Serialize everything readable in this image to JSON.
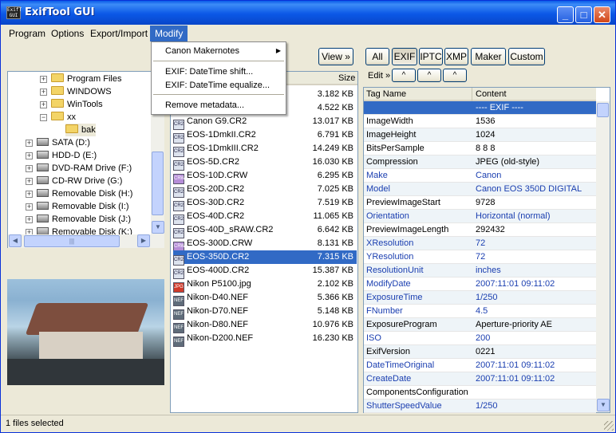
{
  "window": {
    "title": "ExifTool GUI",
    "icon_text": "ExifT GUI"
  },
  "title_buttons": {
    "minimize": "_",
    "maximize": "□",
    "close": "✕"
  },
  "menu": [
    "Program",
    "Options",
    "Export/Import",
    "Modify"
  ],
  "modify_menu": {
    "items": [
      "Canon Makernotes",
      "EXIF: DateTime shift...",
      "EXIF: DateTime equalize...",
      "Remove metadata..."
    ],
    "submenu_arrow": "▶"
  },
  "tree": [
    {
      "label": "Program Files",
      "kind": "folder",
      "pm": "+"
    },
    {
      "label": "WINDOWS",
      "kind": "folder",
      "pm": "+"
    },
    {
      "label": "WinTools",
      "kind": "folder",
      "pm": "+"
    },
    {
      "label": "xx",
      "kind": "folder",
      "pm": "−"
    },
    {
      "label": "bak",
      "kind": "folder",
      "pm": ""
    },
    {
      "label": "SATA (D:)",
      "kind": "drive",
      "pm": "+"
    },
    {
      "label": "HDD-D (E:)",
      "kind": "drive",
      "pm": "+"
    },
    {
      "label": "DVD-RAM Drive (F:)",
      "kind": "drive",
      "pm": "+"
    },
    {
      "label": "CD-RW Drive (G:)",
      "kind": "drive",
      "pm": "+"
    },
    {
      "label": "Removable Disk (H:)",
      "kind": "drive",
      "pm": "+"
    },
    {
      "label": "Removable Disk (I:)",
      "kind": "drive",
      "pm": "+"
    },
    {
      "label": "Removable Disk (J:)",
      "kind": "drive",
      "pm": "+"
    },
    {
      "label": "Removable Disk (K:)",
      "kind": "drive",
      "pm": "+"
    }
  ],
  "file_list": {
    "view_button": "View »",
    "size_header": "Size",
    "files": [
      {
        "name": "",
        "size": "3.182 KB",
        "type": ""
      },
      {
        "name": "",
        "size": "4.522 KB",
        "type": ""
      },
      {
        "name": "Canon G9.CR2",
        "size": "13.017 KB",
        "type": "CR2"
      },
      {
        "name": "EOS-1DmkII.CR2",
        "size": "6.791 KB",
        "type": "CR2"
      },
      {
        "name": "EOS-1DmkIII.CR2",
        "size": "14.249 KB",
        "type": "CR2"
      },
      {
        "name": "EOS-5D.CR2",
        "size": "16.030 KB",
        "type": "CR2"
      },
      {
        "name": "EOS-10D.CRW",
        "size": "6.295 KB",
        "type": "CRW"
      },
      {
        "name": "EOS-20D.CR2",
        "size": "7.025 KB",
        "type": "CR2"
      },
      {
        "name": "EOS-30D.CR2",
        "size": "7.519 KB",
        "type": "CR2"
      },
      {
        "name": "EOS-40D.CR2",
        "size": "11.065 KB",
        "type": "CR2"
      },
      {
        "name": "EOS-40D_sRAW.CR2",
        "size": "6.642 KB",
        "type": "CR2"
      },
      {
        "name": "EOS-300D.CRW",
        "size": "8.131 KB",
        "type": "CRW"
      },
      {
        "name": "EOS-350D.CR2",
        "size": "7.315 KB",
        "type": "CR2",
        "selected": true
      },
      {
        "name": "EOS-400D.CR2",
        "size": "15.387 KB",
        "type": "CR2"
      },
      {
        "name": "Nikon P5100.jpg",
        "size": "2.102 KB",
        "type": "JPG"
      },
      {
        "name": "Nikon-D40.NEF",
        "size": "5.366 KB",
        "type": "NEF"
      },
      {
        "name": "Nikon-D70.NEF",
        "size": "5.148 KB",
        "type": "NEF"
      },
      {
        "name": "Nikon-D80.NEF",
        "size": "10.976 KB",
        "type": "NEF"
      },
      {
        "name": "Nikon-D200.NEF",
        "size": "16.230 KB",
        "type": "NEF"
      }
    ]
  },
  "metadata": {
    "filter_buttons": [
      "All",
      "EXIF",
      "IPTC",
      "XMP",
      "Maker",
      "Custom"
    ],
    "active_filter": "EXIF",
    "edit_label": "Edit »",
    "edit_arrows": [
      "^",
      "^",
      "^"
    ],
    "headers": [
      "Tag Name",
      "Content"
    ],
    "rows": [
      {
        "tag": "",
        "value": "---- EXIF ----",
        "style": "grp"
      },
      {
        "tag": "ImageWidth",
        "value": "1536",
        "style": ""
      },
      {
        "tag": "ImageHeight",
        "value": "1024",
        "style": ""
      },
      {
        "tag": "BitsPerSample",
        "value": "8 8 8",
        "style": ""
      },
      {
        "tag": "Compression",
        "value": "JPEG (old-style)",
        "style": ""
      },
      {
        "tag": "Make",
        "value": "Canon",
        "style": "blue"
      },
      {
        "tag": "Model",
        "value": "Canon EOS 350D DIGITAL",
        "style": "blue"
      },
      {
        "tag": "PreviewImageStart",
        "value": "9728",
        "style": ""
      },
      {
        "tag": "Orientation",
        "value": "Horizontal (normal)",
        "style": "blue"
      },
      {
        "tag": "PreviewImageLength",
        "value": "292432",
        "style": ""
      },
      {
        "tag": "XResolution",
        "value": "72",
        "style": "blue"
      },
      {
        "tag": "YResolution",
        "value": "72",
        "style": "blue"
      },
      {
        "tag": "ResolutionUnit",
        "value": "inches",
        "style": "blue"
      },
      {
        "tag": "ModifyDate",
        "value": "2007:11:01 09:11:02",
        "style": "blue"
      },
      {
        "tag": "ExposureTime",
        "value": "1/250",
        "style": "blue"
      },
      {
        "tag": "FNumber",
        "value": "4.5",
        "style": "blue"
      },
      {
        "tag": "ExposureProgram",
        "value": "Aperture-priority AE",
        "style": ""
      },
      {
        "tag": "ISO",
        "value": "200",
        "style": "blue"
      },
      {
        "tag": "ExifVersion",
        "value": "0221",
        "style": ""
      },
      {
        "tag": "DateTimeOriginal",
        "value": "2007:11:01 09:11:02",
        "style": "blue"
      },
      {
        "tag": "CreateDate",
        "value": "2007:11:01 09:11:02",
        "style": "blue"
      },
      {
        "tag": "ComponentsConfiguration",
        "value": "",
        "style": ""
      },
      {
        "tag": "ShutterSpeedValue",
        "value": "1/250",
        "style": "blue"
      }
    ]
  },
  "status": {
    "text": "1 files selected"
  },
  "scroll_arrows": {
    "up": "▲",
    "down": "▼",
    "left": "◀",
    "right": "▶",
    "grip": "|||"
  }
}
